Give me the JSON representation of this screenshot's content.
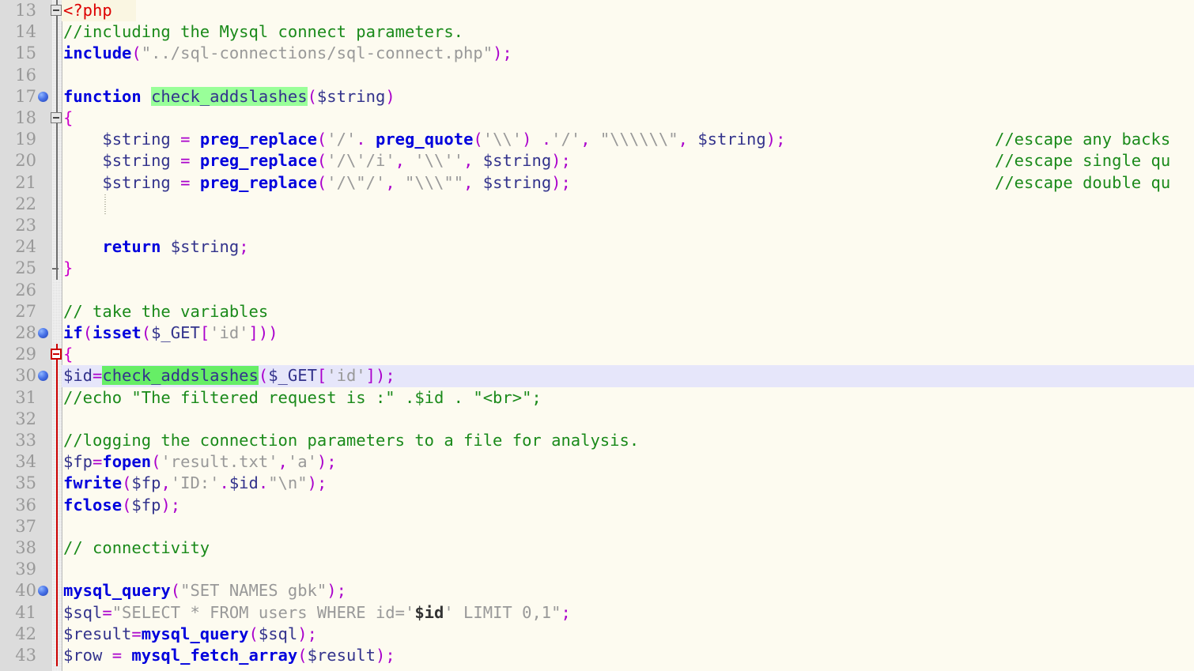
{
  "editor": {
    "language": "php",
    "first_visible_line": 13,
    "last_visible_line": 43,
    "current_line": 30,
    "colors": {
      "background": "#fdfbf0",
      "gutter_background": "#dcdcdc",
      "line_number": "#999999",
      "current_line_highlight": "#e6e6fa",
      "comment": "#1a8a1a",
      "keyword": "#0000dd",
      "string": "#999999",
      "variable": "#33338c",
      "punctuation": "#aa00cc",
      "php_tag": "#dd0000",
      "search_highlight": "#99ff99",
      "search_highlight_active": "#66ee66",
      "fold_line": "#6e6e6e",
      "fold_line_active": "#cc0000",
      "bookmark_dot": "#2a50c8"
    },
    "bookmark_lines": [
      17,
      28,
      30,
      40
    ],
    "fold_open_lines": [
      13,
      18,
      29
    ],
    "fold_end_lines": [
      25
    ],
    "fold_active_start": 29,
    "search_term": "check_addslashes"
  },
  "lines": [
    {
      "n": 13,
      "text": "<?php",
      "tokens": [
        {
          "t": "<?php",
          "c": "t-tag"
        }
      ]
    },
    {
      "n": 14,
      "text": "//including the Mysql connect parameters.",
      "tokens": [
        {
          "t": "//including the Mysql connect parameters.",
          "c": "t-comment"
        }
      ]
    },
    {
      "n": 15,
      "text": "include(\"../sql-connections/sql-connect.php\");",
      "tokens": [
        {
          "t": "include",
          "c": "t-kw"
        },
        {
          "t": "(",
          "c": "t-punc"
        },
        {
          "t": "\"../sql-connections/sql-connect.php\"",
          "c": "t-str"
        },
        {
          "t": ")",
          "c": "t-punc"
        },
        {
          "t": ";",
          "c": "t-punc"
        }
      ]
    },
    {
      "n": 16,
      "text": "",
      "tokens": []
    },
    {
      "n": 17,
      "text": "function check_addslashes($string)",
      "tokens": [
        {
          "t": "function",
          "c": "t-kw"
        },
        {
          "t": " ",
          "c": "t-plain"
        },
        {
          "t": "check_addslashes",
          "c": "t-plain hl-green"
        },
        {
          "t": "(",
          "c": "t-punc"
        },
        {
          "t": "$string",
          "c": "t-var"
        },
        {
          "t": ")",
          "c": "t-punc"
        }
      ]
    },
    {
      "n": 18,
      "text": "{",
      "tokens": [
        {
          "t": "{",
          "c": "t-brace"
        }
      ]
    },
    {
      "n": 19,
      "text": "    $string = preg_replace('/'. preg_quote('\\\\') .'/', \"\\\\\\\\\\\\\", $string);",
      "comment": "//escape any backs",
      "tokens": [
        {
          "t": "    ",
          "c": "t-plain"
        },
        {
          "t": "$string",
          "c": "t-var"
        },
        {
          "t": " ",
          "c": "t-plain"
        },
        {
          "t": "=",
          "c": "t-op"
        },
        {
          "t": " ",
          "c": "t-plain"
        },
        {
          "t": "preg_replace",
          "c": "t-fn"
        },
        {
          "t": "(",
          "c": "t-punc"
        },
        {
          "t": "'/'",
          "c": "t-str"
        },
        {
          "t": ".",
          "c": "t-op"
        },
        {
          "t": " ",
          "c": "t-plain"
        },
        {
          "t": "preg_quote",
          "c": "t-fn"
        },
        {
          "t": "(",
          "c": "t-punc"
        },
        {
          "t": "'\\\\'",
          "c": "t-str"
        },
        {
          "t": ")",
          "c": "t-punc"
        },
        {
          "t": " ",
          "c": "t-plain"
        },
        {
          "t": ".",
          "c": "t-op"
        },
        {
          "t": "'/'",
          "c": "t-str"
        },
        {
          "t": ",",
          "c": "t-punc"
        },
        {
          "t": " ",
          "c": "t-plain"
        },
        {
          "t": "\"\\\\\\\\\\\\\"",
          "c": "t-str"
        },
        {
          "t": ",",
          "c": "t-punc"
        },
        {
          "t": " ",
          "c": "t-plain"
        },
        {
          "t": "$string",
          "c": "t-var"
        },
        {
          "t": ")",
          "c": "t-punc"
        },
        {
          "t": ";",
          "c": "t-punc"
        }
      ]
    },
    {
      "n": 20,
      "text": "    $string = preg_replace('/\\'/i', '\\\\'', $string);",
      "comment": "//escape single qu",
      "tokens": [
        {
          "t": "    ",
          "c": "t-plain"
        },
        {
          "t": "$string",
          "c": "t-var"
        },
        {
          "t": " ",
          "c": "t-plain"
        },
        {
          "t": "=",
          "c": "t-op"
        },
        {
          "t": " ",
          "c": "t-plain"
        },
        {
          "t": "preg_replace",
          "c": "t-fn"
        },
        {
          "t": "(",
          "c": "t-punc"
        },
        {
          "t": "'/\\'/i'",
          "c": "t-str"
        },
        {
          "t": ",",
          "c": "t-punc"
        },
        {
          "t": " ",
          "c": "t-plain"
        },
        {
          "t": "'\\\\''",
          "c": "t-str"
        },
        {
          "t": ",",
          "c": "t-punc"
        },
        {
          "t": " ",
          "c": "t-plain"
        },
        {
          "t": "$string",
          "c": "t-var"
        },
        {
          "t": ")",
          "c": "t-punc"
        },
        {
          "t": ";",
          "c": "t-punc"
        }
      ]
    },
    {
      "n": 21,
      "text": "    $string = preg_replace('/\\\"/', \"\\\\\\\"\", $string);",
      "comment": "//escape double qu",
      "tokens": [
        {
          "t": "    ",
          "c": "t-plain"
        },
        {
          "t": "$string",
          "c": "t-var"
        },
        {
          "t": " ",
          "c": "t-plain"
        },
        {
          "t": "=",
          "c": "t-op"
        },
        {
          "t": " ",
          "c": "t-plain"
        },
        {
          "t": "preg_replace",
          "c": "t-fn"
        },
        {
          "t": "(",
          "c": "t-punc"
        },
        {
          "t": "'/\\\"/'",
          "c": "t-str"
        },
        {
          "t": ",",
          "c": "t-punc"
        },
        {
          "t": " ",
          "c": "t-plain"
        },
        {
          "t": "\"\\\\\\\"\"",
          "c": "t-str"
        },
        {
          "t": ",",
          "c": "t-punc"
        },
        {
          "t": " ",
          "c": "t-plain"
        },
        {
          "t": "$string",
          "c": "t-var"
        },
        {
          "t": ")",
          "c": "t-punc"
        },
        {
          "t": ";",
          "c": "t-punc"
        }
      ]
    },
    {
      "n": 22,
      "text": "",
      "tokens": [],
      "indent_guide": true
    },
    {
      "n": 23,
      "text": "",
      "tokens": []
    },
    {
      "n": 24,
      "text": "    return $string;",
      "tokens": [
        {
          "t": "    ",
          "c": "t-plain"
        },
        {
          "t": "return",
          "c": "t-kw"
        },
        {
          "t": " ",
          "c": "t-plain"
        },
        {
          "t": "$string",
          "c": "t-var"
        },
        {
          "t": ";",
          "c": "t-punc"
        }
      ]
    },
    {
      "n": 25,
      "text": "}",
      "tokens": [
        {
          "t": "}",
          "c": "t-brace"
        }
      ]
    },
    {
      "n": 26,
      "text": "",
      "tokens": []
    },
    {
      "n": 27,
      "text": "// take the variables",
      "tokens": [
        {
          "t": "// take the variables",
          "c": "t-comment"
        }
      ]
    },
    {
      "n": 28,
      "text": "if(isset($_GET['id']))",
      "tokens": [
        {
          "t": "if",
          "c": "t-kw"
        },
        {
          "t": "(",
          "c": "t-punc"
        },
        {
          "t": "isset",
          "c": "t-kw"
        },
        {
          "t": "(",
          "c": "t-punc"
        },
        {
          "t": "$_GET",
          "c": "t-var"
        },
        {
          "t": "[",
          "c": "t-punc"
        },
        {
          "t": "'id'",
          "c": "t-str"
        },
        {
          "t": "]",
          "c": "t-punc"
        },
        {
          "t": ")",
          "c": "t-punc"
        },
        {
          "t": ")",
          "c": "t-punc"
        }
      ]
    },
    {
      "n": 29,
      "text": "{",
      "tokens": [
        {
          "t": "{",
          "c": "t-brace"
        }
      ]
    },
    {
      "n": 30,
      "text": "$id=check_addslashes($_GET['id']);",
      "tokens": [
        {
          "t": "$id",
          "c": "t-var"
        },
        {
          "t": "=",
          "c": "t-op"
        },
        {
          "t": "check_addslashes",
          "c": "t-plain hl-green2"
        },
        {
          "t": "(",
          "c": "t-punc"
        },
        {
          "t": "$_GET",
          "c": "t-var"
        },
        {
          "t": "[",
          "c": "t-punc"
        },
        {
          "t": "'id'",
          "c": "t-str"
        },
        {
          "t": "]",
          "c": "t-punc"
        },
        {
          "t": ")",
          "c": "t-punc"
        },
        {
          "t": ";",
          "c": "t-punc"
        }
      ]
    },
    {
      "n": 31,
      "text": "//echo \"The filtered request is :\" .$id . \"<br>\";",
      "tokens": [
        {
          "t": "//echo \"The filtered request is :\" .$id . \"<br>\";",
          "c": "t-comment"
        }
      ]
    },
    {
      "n": 32,
      "text": "",
      "tokens": []
    },
    {
      "n": 33,
      "text": "//logging the connection parameters to a file for analysis.",
      "tokens": [
        {
          "t": "//logging the connection parameters to a file for analysis.",
          "c": "t-comment"
        }
      ]
    },
    {
      "n": 34,
      "text": "$fp=fopen('result.txt','a');",
      "tokens": [
        {
          "t": "$fp",
          "c": "t-var"
        },
        {
          "t": "=",
          "c": "t-op"
        },
        {
          "t": "fopen",
          "c": "t-fn"
        },
        {
          "t": "(",
          "c": "t-punc"
        },
        {
          "t": "'result.txt'",
          "c": "t-str"
        },
        {
          "t": ",",
          "c": "t-punc"
        },
        {
          "t": "'a'",
          "c": "t-str"
        },
        {
          "t": ")",
          "c": "t-punc"
        },
        {
          "t": ";",
          "c": "t-punc"
        }
      ]
    },
    {
      "n": 35,
      "text": "fwrite($fp,'ID:'.$id.\"\\n\");",
      "tokens": [
        {
          "t": "fwrite",
          "c": "t-fn"
        },
        {
          "t": "(",
          "c": "t-punc"
        },
        {
          "t": "$fp",
          "c": "t-var"
        },
        {
          "t": ",",
          "c": "t-punc"
        },
        {
          "t": "'ID:'",
          "c": "t-str"
        },
        {
          "t": ".",
          "c": "t-op"
        },
        {
          "t": "$id",
          "c": "t-var"
        },
        {
          "t": ".",
          "c": "t-op"
        },
        {
          "t": "\"\\n\"",
          "c": "t-str"
        },
        {
          "t": ")",
          "c": "t-punc"
        },
        {
          "t": ";",
          "c": "t-punc"
        }
      ]
    },
    {
      "n": 36,
      "text": "fclose($fp);",
      "tokens": [
        {
          "t": "fclose",
          "c": "t-fn"
        },
        {
          "t": "(",
          "c": "t-punc"
        },
        {
          "t": "$fp",
          "c": "t-var"
        },
        {
          "t": ")",
          "c": "t-punc"
        },
        {
          "t": ";",
          "c": "t-punc"
        }
      ]
    },
    {
      "n": 37,
      "text": "",
      "tokens": []
    },
    {
      "n": 38,
      "text": "// connectivity",
      "tokens": [
        {
          "t": "// connectivity",
          "c": "t-comment"
        }
      ]
    },
    {
      "n": 39,
      "text": "",
      "tokens": []
    },
    {
      "n": 40,
      "text": "mysql_query(\"SET NAMES gbk\");",
      "tokens": [
        {
          "t": "mysql_query",
          "c": "t-fn"
        },
        {
          "t": "(",
          "c": "t-punc"
        },
        {
          "t": "\"SET NAMES gbk\"",
          "c": "t-str"
        },
        {
          "t": ")",
          "c": "t-punc"
        },
        {
          "t": ";",
          "c": "t-punc"
        }
      ]
    },
    {
      "n": 41,
      "text": "$sql=\"SELECT * FROM users WHERE id='$id' LIMIT 0,1\";",
      "tokens": [
        {
          "t": "$sql",
          "c": "t-var"
        },
        {
          "t": "=",
          "c": "t-op"
        },
        {
          "t": "\"SELECT * FROM users WHERE id='",
          "c": "t-str"
        },
        {
          "t": "$id",
          "c": "t-interp"
        },
        {
          "t": "' LIMIT 0,1\"",
          "c": "t-str"
        },
        {
          "t": ";",
          "c": "t-punc"
        }
      ]
    },
    {
      "n": 42,
      "text": "$result=mysql_query($sql);",
      "tokens": [
        {
          "t": "$result",
          "c": "t-var"
        },
        {
          "t": "=",
          "c": "t-op"
        },
        {
          "t": "mysql_query",
          "c": "t-fn"
        },
        {
          "t": "(",
          "c": "t-punc"
        },
        {
          "t": "$sql",
          "c": "t-var"
        },
        {
          "t": ")",
          "c": "t-punc"
        },
        {
          "t": ";",
          "c": "t-punc"
        }
      ]
    },
    {
      "n": 43,
      "text": "$row = mysql_fetch_array($result);",
      "tokens": [
        {
          "t": "$row",
          "c": "t-var"
        },
        {
          "t": " ",
          "c": "t-plain"
        },
        {
          "t": "=",
          "c": "t-op"
        },
        {
          "t": " ",
          "c": "t-plain"
        },
        {
          "t": "mysql_fetch_array",
          "c": "t-fn"
        },
        {
          "t": "(",
          "c": "t-punc"
        },
        {
          "t": "$result",
          "c": "t-var"
        },
        {
          "t": ")",
          "c": "t-punc"
        },
        {
          "t": ";",
          "c": "t-punc"
        }
      ]
    }
  ]
}
